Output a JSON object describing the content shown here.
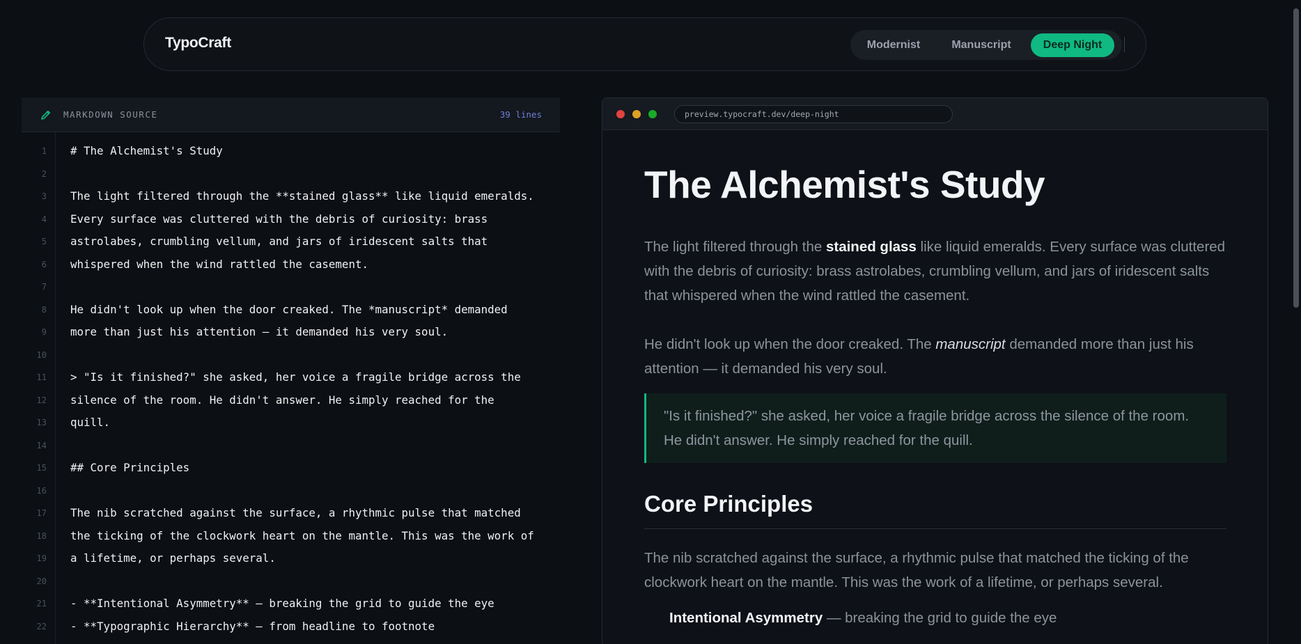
{
  "header": {
    "logo": "TypoCraft",
    "themes": [
      {
        "label": "Modernist",
        "active": false
      },
      {
        "label": "Manuscript",
        "active": false
      },
      {
        "label": "Deep Night",
        "active": true
      }
    ]
  },
  "editor": {
    "title": "MARKDOWN SOURCE",
    "line_count": "39 lines",
    "lines": [
      {
        "n": "1",
        "text": "# The Alchemist's Study"
      },
      {
        "n": "2",
        "text": ""
      },
      {
        "n": "3",
        "text": "The light filtered through the **stained glass** like liquid emeralds."
      },
      {
        "n": "4",
        "text": "Every surface was cluttered with the debris of curiosity: brass"
      },
      {
        "n": "5",
        "text": "astrolabes, crumbling vellum, and jars of iridescent salts that"
      },
      {
        "n": "6",
        "text": "whispered when the wind rattled the casement."
      },
      {
        "n": "7",
        "text": ""
      },
      {
        "n": "8",
        "text": "He didn't look up when the door creaked. The *manuscript* demanded"
      },
      {
        "n": "9",
        "text": "more than just his attention — it demanded his very soul."
      },
      {
        "n": "10",
        "text": ""
      },
      {
        "n": "11",
        "text": "> \"Is it finished?\" she asked, her voice a fragile bridge across the"
      },
      {
        "n": "12",
        "text": "silence of the room. He didn't answer. He simply reached for the"
      },
      {
        "n": "13",
        "text": "quill."
      },
      {
        "n": "14",
        "text": ""
      },
      {
        "n": "15",
        "text": "## Core Principles"
      },
      {
        "n": "16",
        "text": ""
      },
      {
        "n": "17",
        "text": "The nib scratched against the surface, a rhythmic pulse that matched"
      },
      {
        "n": "18",
        "text": "the ticking of the clockwork heart on the mantle. This was the work of"
      },
      {
        "n": "19",
        "text": "a lifetime, or perhaps several."
      },
      {
        "n": "20",
        "text": ""
      },
      {
        "n": "21",
        "text": "- **Intentional Asymmetry** — breaking the grid to guide the eye"
      },
      {
        "n": "22",
        "text": "- **Typographic Hierarchy** — from headline to footnote"
      }
    ]
  },
  "preview": {
    "url": "preview.typocraft.dev/deep-night",
    "dots": [
      "#e0443e",
      "#dea123",
      "#1aab29"
    ],
    "h1": "The Alchemist's Study",
    "p1_a": "The light filtered through the ",
    "p1_b": "stained glass",
    "p1_c": " like liquid emeralds. Every surface was cluttered with the debris of curiosity: brass astrolabes, crumbling vellum, and jars of iridescent salts that whispered when the wind rattled the casement.",
    "p2_a": "He didn't look up when the door creaked. The ",
    "p2_b": "manuscript",
    "p2_c": " demanded more than just his attention — it demanded his very soul.",
    "quote": "\"Is it finished?\" she asked, her voice a fragile bridge across the silence of the room. He didn't answer. He simply reached for the quill.",
    "h2": "Core Principles",
    "p3": "The nib scratched against the surface, a rhythmic pulse that matched the ticking of the clockwork heart on the mantle. This was the work of a lifetime, or perhaps several.",
    "li1_b": "Intentional Asymmetry",
    "li1_c": " — breaking the grid to guide the eye"
  },
  "colors": {
    "accent": "#10b981",
    "background": "#0c0f14"
  }
}
